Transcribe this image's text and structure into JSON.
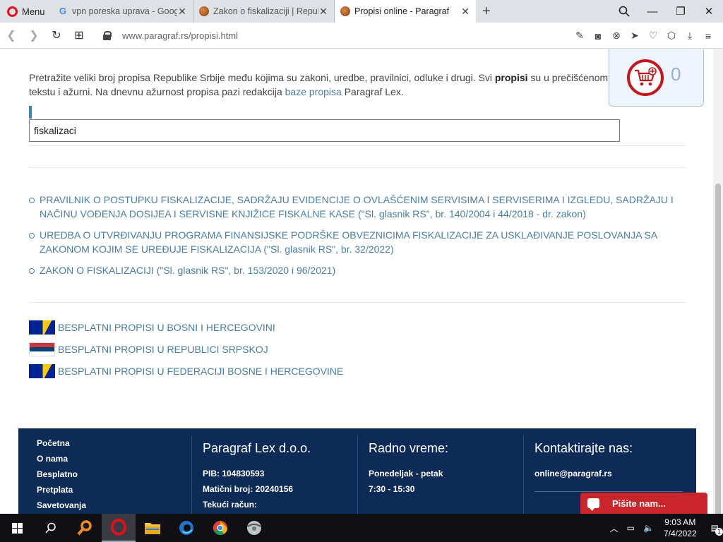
{
  "browser": {
    "menu_label": "Menu",
    "tabs": [
      {
        "title": "vpn poreska uprava - Google",
        "favicon": "google-favicon"
      },
      {
        "title": "Zakon o fiskalizaciji | Republika",
        "favicon": "paragraf-favicon"
      },
      {
        "title": "Propisi online - Paragraf",
        "favicon": "paragraf-favicon"
      }
    ],
    "url": "www.paragraf.rs/propisi.html"
  },
  "page": {
    "intro_part1": "Pretražite veliki broj propisa Republike Srbije među kojima su zakoni, uredbe, pravilnici, odluke i drugi. Svi ",
    "intro_bold": "propisi",
    "intro_part2": " su u prečišćenom tekstu i ažurni. Na dnevnu ažurnost propisa pazi redakcija ",
    "intro_link": "baze propisa",
    "intro_part3": " Paragraf Lex.",
    "cart_count": "0",
    "search_value": "fiskalizaci",
    "results": [
      "PRAVILNIK O POSTUPKU FISKALIZACIJE, SADRŽAJU EVIDENCIJE O OVLAŠĆENIM SERVISIMA I SERVISERIMA I IZGLEDU, SADRŽAJU I NAČINU VOĐENJA DOSIJEA I SERVISNE KNJIŽICE FISKALNE KASE (\"Sl. glasnik RS\", br. 140/2004 i 44/2018 - dr. zakon)",
      "UREDBA O UTVRĐIVANJU PROGRAMA FINANSIJSKE PODRŠKE OBVEZNICIMA FISKALIZACIJE ZA USKLAĐIVANJE POSLOVANJA SA ZAKONOM KOJIM SE UREĐUJE FISKALIZACIJA (\"Sl. glasnik RS\", br. 32/2022)",
      "ZAKON O FISKALIZACIJI (\"Sl. glasnik RS\", br. 153/2020 i 96/2021)"
    ],
    "free_links": [
      "BESPLATNI PROPISI U BOSNI I HERCEGOVINI",
      "BESPLATNI PROPISI U REPUBLICI SRPSKOJ",
      "BESPLATNI PROPISI U FEDERACIJI BOSNE I HERCEGOVINE"
    ]
  },
  "footer": {
    "menu": [
      "Početna",
      "O nama",
      "Besplatno",
      "Pretplata",
      "Savetovanja"
    ],
    "company": {
      "title": "Paragraf Lex d.o.o.",
      "pib": "PIB: 104830593",
      "maticni": "Matični broj: 20240156",
      "racun": "Tekući račun:"
    },
    "hours": {
      "title": "Radno vreme:",
      "days": "Ponedeljak - petak",
      "time": "7:30 - 15:30"
    },
    "contact": {
      "title": "Kontaktirajte nas:",
      "email": "online@paragraf.rs"
    }
  },
  "chat_label": "Pišite nam...",
  "taskbar": {
    "time": "9:03 AM",
    "date": "7/4/2022",
    "notification_count": "1"
  },
  "colors": {
    "link": "#4a7ea6",
    "footer_bg": "#0e2b57",
    "chat_bg": "#c9252b",
    "cart_red": "#c4161c"
  }
}
